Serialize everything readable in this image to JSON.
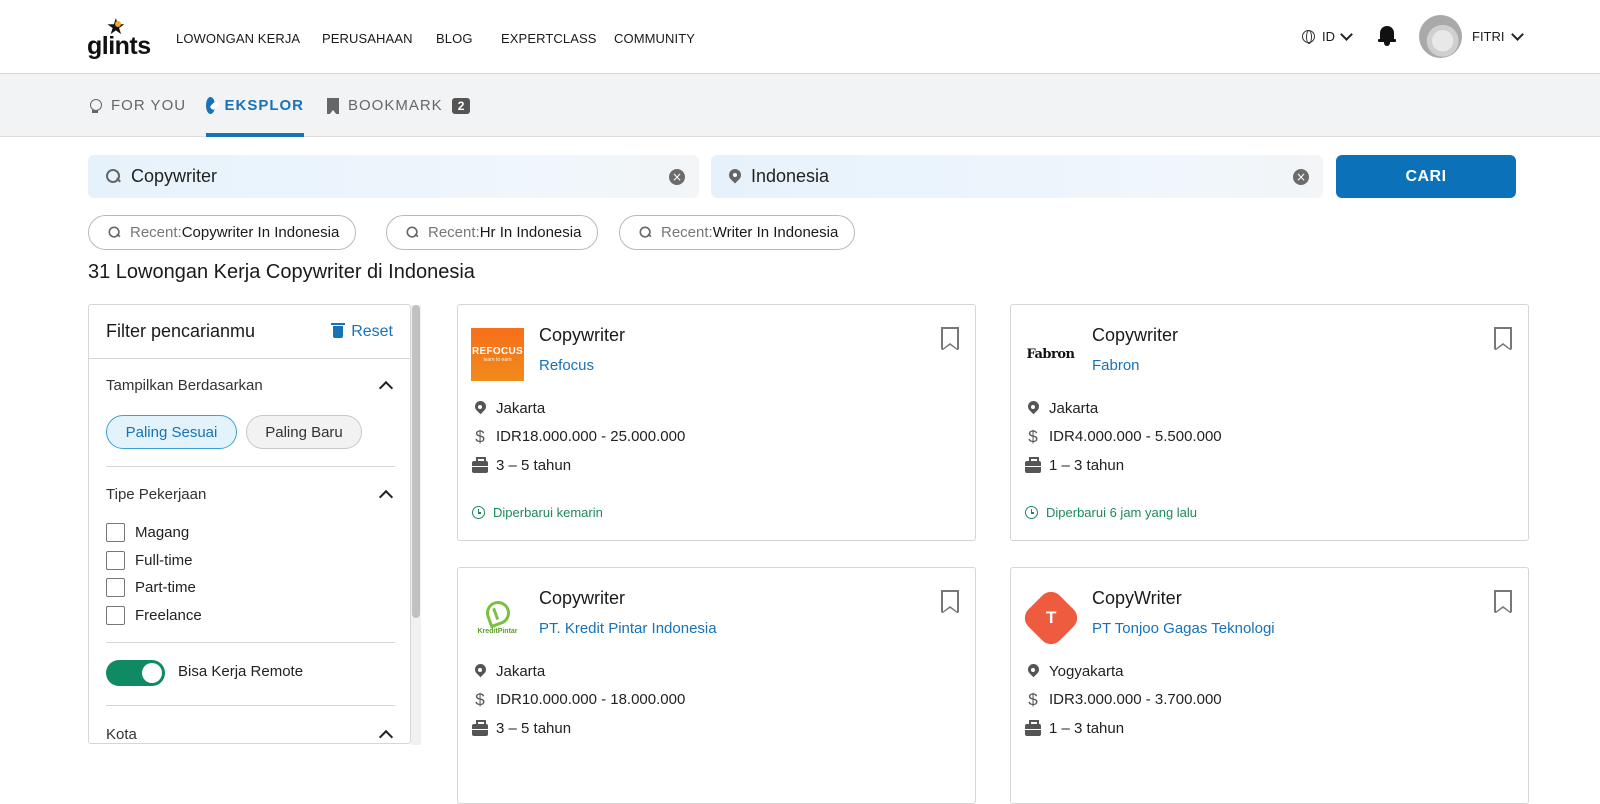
{
  "nav": {
    "logo": "glints",
    "links": [
      "LOWONGAN KERJA",
      "PERUSAHAAN",
      "BLOG",
      "EXPERTCLASS",
      "COMMUNITY"
    ],
    "language": "ID",
    "user_name": "FITRI"
  },
  "tabs": {
    "for_you": "FOR YOU",
    "eksplor": "EKSPLOR",
    "bookmark": "BOOKMARK",
    "bookmark_count": "2"
  },
  "search": {
    "query": "Copywriter",
    "location": "Indonesia",
    "button": "CARI"
  },
  "recent": [
    {
      "prefix": "Recent:",
      "term": "Copywriter In Indonesia"
    },
    {
      "prefix": "Recent:",
      "term": "Hr In Indonesia"
    },
    {
      "prefix": "Recent:",
      "term": "Writer In Indonesia"
    }
  ],
  "results_title": "31 Lowongan Kerja Copywriter di Indonesia",
  "filter": {
    "title": "Filter pencarianmu",
    "reset": "Reset",
    "sort_title": "Tampilkan Berdasarkan",
    "sort_options": [
      "Paling Sesuai",
      "Paling Baru"
    ],
    "job_type_title": "Tipe Pekerjaan",
    "job_types": [
      "Magang",
      "Full-time",
      "Part-time",
      "Freelance"
    ],
    "remote_label": "Bisa Kerja Remote",
    "city_title": "Kota"
  },
  "jobs": [
    {
      "title": "Copywriter",
      "company": "Refocus",
      "logo_text": "REFOCUS",
      "logo_sub": "learn to earn",
      "location": "Jakarta",
      "salary": "IDR18.000.000 - 25.000.000",
      "experience": "3 – 5 tahun",
      "updated": "Diperbarui kemarin"
    },
    {
      "title": "Copywriter",
      "company": "Fabron",
      "logo_text": "Fabron",
      "location": "Jakarta",
      "salary": "IDR4.000.000 - 5.500.000",
      "experience": "1 – 3 tahun",
      "updated": "Diperbarui 6 jam yang lalu"
    },
    {
      "title": "Copywriter",
      "company": "PT. Kredit Pintar Indonesia",
      "logo_text": "KreditPintar",
      "location": "Jakarta",
      "salary": "IDR10.000.000 - 18.000.000",
      "experience": "3 – 5 tahun"
    },
    {
      "title": "CopyWriter",
      "company": "PT Tonjoo Gagas Teknologi",
      "logo_text": "T",
      "location": "Yogyakarta",
      "salary": "IDR3.000.000 - 3.700.000",
      "experience": "1 – 3 tahun"
    }
  ],
  "colors": {
    "brand_blue": "#1772b8",
    "button_blue": "#0b72b9",
    "toggle_green": "#0f8a62",
    "updated_green": "#1d8a5a"
  }
}
